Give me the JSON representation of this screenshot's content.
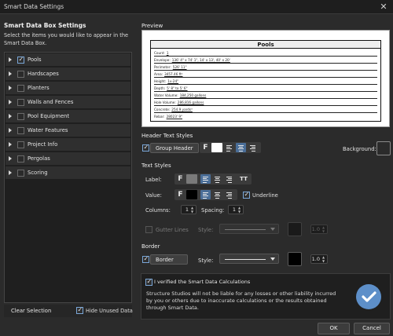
{
  "window": {
    "title": "Smart Data Settings",
    "close_glyph": "✕"
  },
  "left": {
    "heading": "Smart Data Box Settings",
    "description": "Select the items you would like to appear in the Smart Data Box.",
    "items": [
      {
        "label": "Pools",
        "checked": true
      },
      {
        "label": "Hardscapes",
        "checked": false
      },
      {
        "label": "Planters",
        "checked": false
      },
      {
        "label": "Walls and Fences",
        "checked": false
      },
      {
        "label": "Pool Equipment",
        "checked": false
      },
      {
        "label": "Water Features",
        "checked": false
      },
      {
        "label": "Project Info",
        "checked": false
      },
      {
        "label": "Pergolas",
        "checked": false
      },
      {
        "label": "Scoring",
        "checked": false
      }
    ],
    "clear_label": "Clear Selection",
    "hide_unused_label": "Hide Unused Data"
  },
  "preview": {
    "heading": "Preview",
    "title": "Pools",
    "lines": [
      {
        "label": "Count:",
        "value": "1"
      },
      {
        "label": "Envelope:",
        "value": "136' 4\" x 74' 1\", 14' x 13', 40' x 20'"
      },
      {
        "label": "Perimeter:",
        "value": "526' 11\""
      },
      {
        "label": "Area:",
        "value": "3457.46 ft²"
      },
      {
        "label": "Height:",
        "value": "1v-24\""
      },
      {
        "label": "Depth:",
        "value": "5' 8\" to 5' 6\""
      },
      {
        "label": "Water Volume:",
        "value": "184,250 gallons"
      },
      {
        "label": "Hole Volume:",
        "value": "286,816 gallons"
      },
      {
        "label": "Concrete:",
        "value": "254.9 yards³"
      },
      {
        "label": "Rebar:",
        "value": "28023' 9\""
      }
    ]
  },
  "header_styles": {
    "heading": "Header Text Styles",
    "group_header_label": "Group Header",
    "background_label": "Background:",
    "font_glyph": "F",
    "swatch_color": "#ffffff",
    "background_color": "#2b2b2b"
  },
  "text_styles": {
    "heading": "Text Styles",
    "label_label": "Label:",
    "value_label": "Value:",
    "font_glyph": "F",
    "tt_glyph": "TT",
    "label_swatch_color": "#7a7a7a",
    "value_swatch_color": "#000000",
    "underline_label": "Underline",
    "columns_label": "Columns:",
    "columns_value": "1",
    "spacing_label": "Spacing:",
    "spacing_value": "1",
    "gutter_label": "Gutter Lines",
    "style_label": "Style:",
    "gutter_width_value": "1.0"
  },
  "border": {
    "heading": "Border",
    "border_label": "Border",
    "style_label": "Style:",
    "color": "#000000",
    "width_value": "1.0"
  },
  "notice": {
    "checkbox_label": "I verified the Smart Data Calculations",
    "text": "Structure Studios will not be liable for any losses or other liability incurred by you or others due to inaccurate calculations or the results obtained through Smart Data.",
    "badge_color": "#5d8fc9"
  },
  "footer": {
    "ok_label": "OK",
    "cancel_label": "Cancel"
  },
  "colors": {
    "accent": "#4a6e98",
    "bg": "#2b2b2b"
  }
}
